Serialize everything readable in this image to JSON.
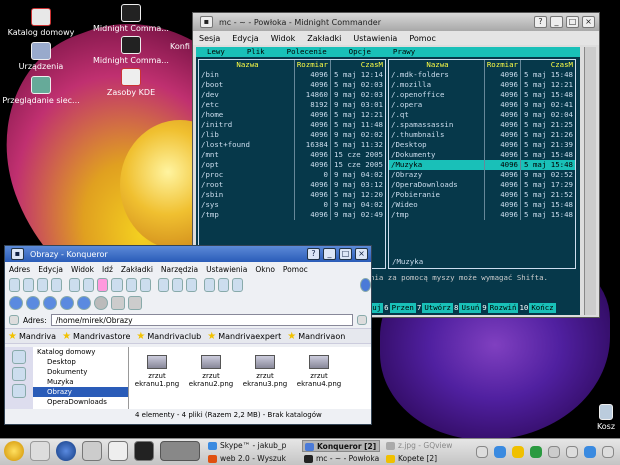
{
  "colors": {
    "accent_teal": "#19c0b8",
    "konqueror_blue": "#2a5cb8",
    "terminal_bg": "#06384a",
    "function_label": "#ffff44"
  },
  "desktop": {
    "icons": [
      {
        "label": "Katalog domowy",
        "icon": "home-folder-icon"
      },
      {
        "label": "Urządzenia",
        "icon": "computer-icon"
      },
      {
        "label": "Przeglądanie siec...",
        "icon": "network-icon"
      },
      {
        "label": "Midnight Comma...",
        "icon": "terminal-icon"
      },
      {
        "label": "Midnight Comma...",
        "icon": "terminal-icon"
      },
      {
        "label": "Zasoby KDE",
        "icon": "kde-resources-icon"
      },
      {
        "label": "Konfi",
        "icon": "config-icon"
      },
      {
        "label": "Kosz",
        "icon": "trash-icon"
      }
    ]
  },
  "mc": {
    "title": "mc - ~ - Powłoka - Midnight Commander",
    "menu": [
      "Sesja",
      "Edycja",
      "Widok",
      "Zakładki",
      "Ustawienia",
      "Pomoc"
    ],
    "topbar": [
      "Lewy",
      "Plik",
      "Polecenie",
      "Opcje",
      "Prawy"
    ],
    "panel_headers": {
      "name": "Nazwa",
      "size": "Rozmiar",
      "time": "CzasM"
    },
    "left_rows": [
      {
        "name": "/bin",
        "size": "4096",
        "time": "5 maj 12:14"
      },
      {
        "name": "/boot",
        "size": "4096",
        "time": "5 maj 02:03"
      },
      {
        "name": "/dev",
        "size": "14860",
        "time": "9 maj 02:03"
      },
      {
        "name": "/etc",
        "size": "8192",
        "time": "9 maj 03:01"
      },
      {
        "name": "/home",
        "size": "4096",
        "time": "5 maj 12:21"
      },
      {
        "name": "/initrd",
        "size": "4096",
        "time": "5 maj 11:48"
      },
      {
        "name": "/lib",
        "size": "4096",
        "time": "9 maj 02:02"
      },
      {
        "name": "/lost+found",
        "size": "16384",
        "time": "5 maj 11:32"
      },
      {
        "name": "/mnt",
        "size": "4096",
        "time": "15 cze 2005"
      },
      {
        "name": "/opt",
        "size": "4096",
        "time": "15 cze 2005"
      },
      {
        "name": "/proc",
        "size": "0",
        "time": "9 maj 04:02"
      },
      {
        "name": "/root",
        "size": "4096",
        "time": "9 maj 03:12"
      },
      {
        "name": "/sbin",
        "size": "4096",
        "time": "5 maj 12:20"
      },
      {
        "name": "/sys",
        "size": "0",
        "time": "9 maj 04:02"
      },
      {
        "name": "/tmp",
        "size": "4096",
        "time": "9 maj 02:49"
      }
    ],
    "right_rows": [
      {
        "name": "/.mdk-folders",
        "size": "4096",
        "time": "5 maj 15:48"
      },
      {
        "name": "/.mozilla",
        "size": "4096",
        "time": "5 maj 12:21"
      },
      {
        "name": "/.openoffice",
        "size": "4096",
        "time": "5 maj 15:48"
      },
      {
        "name": "/.opera",
        "size": "4096",
        "time": "9 maj 02:41"
      },
      {
        "name": "/.qt",
        "size": "4096",
        "time": "9 maj 02:04"
      },
      {
        "name": "/.spamassassin",
        "size": "4096",
        "time": "5 maj 21:25"
      },
      {
        "name": "/.thumbnails",
        "size": "4096",
        "time": "5 maj 21:26"
      },
      {
        "name": "/Desktop",
        "size": "4096",
        "time": "5 maj 21:39"
      },
      {
        "name": "/Dokumenty",
        "size": "4096",
        "time": "5 maj 15:48"
      },
      {
        "name": "/Muzyka",
        "size": "4096",
        "time": "5 maj 15:48",
        "selected": true
      },
      {
        "name": "/Obrazy",
        "size": "4096",
        "time": "9 maj 02:52"
      },
      {
        "name": "/OperaDownloads",
        "size": "4096",
        "time": "5 maj 17:29"
      },
      {
        "name": "/Pobieranie",
        "size": "4096",
        "time": "5 maj 21:52"
      },
      {
        "name": "/Wideo",
        "size": "4096",
        "time": "5 maj 15:48"
      },
      {
        "name": "/tmp",
        "size": "4096",
        "time": "5 maj 15:48"
      }
    ],
    "left_footer": "",
    "right_footer": "/Muzyka",
    "hint": "nia za pomocą myszy może wymagać Shifta.",
    "fkeys": [
      {
        "num": "5",
        "label": "Kopiuj"
      },
      {
        "num": "6",
        "label": "Przen"
      },
      {
        "num": "7",
        "label": "Utwórz"
      },
      {
        "num": "8",
        "label": "Usuń"
      },
      {
        "num": "9",
        "label": "Rozwiń"
      },
      {
        "num": "10",
        "label": "Kończ"
      }
    ]
  },
  "konqueror": {
    "title": "Obrazy - Konqueror",
    "menu": [
      "Adres",
      "Edycja",
      "Widok",
      "Idź",
      "Zakładki",
      "Narzędzia",
      "Ustawienia",
      "Okno",
      "Pomoc"
    ],
    "address_label": "Adres:",
    "address_value": "/home/mirek/Obrazy",
    "bookmarks": [
      "Mandriva",
      "Mandrivastore",
      "Mandrivaclub",
      "Mandrivaexpert",
      "Mandrivaon"
    ],
    "tree": [
      {
        "label": "Katalog domowy"
      },
      {
        "label": "Desktop"
      },
      {
        "label": "Dokumenty"
      },
      {
        "label": "Muzyka"
      },
      {
        "label": "Obrazy",
        "selected": true
      },
      {
        "label": "OperaDownloads"
      }
    ],
    "files": [
      {
        "name": "zrzut ekranu1.png"
      },
      {
        "name": "zrzut ekranu2.png"
      },
      {
        "name": "zrzut ekranu3.png"
      },
      {
        "name": "zrzut ekranu4.png"
      }
    ],
    "status": "4 elementy - 4 pliki (Razem 2,2 MB) - Brak katalogów"
  },
  "taskbar": {
    "tasks_top": [
      {
        "label": "Skype™ - jakub_p",
        "active": false
      },
      {
        "label": "Konqueror [2]",
        "active": true
      },
      {
        "label": "z.jpg - GQview",
        "active": false,
        "dim": true
      }
    ],
    "tasks_bottom": [
      {
        "label": "web 2.0 - Wyszuk",
        "active": false
      },
      {
        "label": "mc - ~ - Powłoka",
        "active": false
      },
      {
        "label": "Kopete [2]",
        "active": false
      }
    ]
  }
}
